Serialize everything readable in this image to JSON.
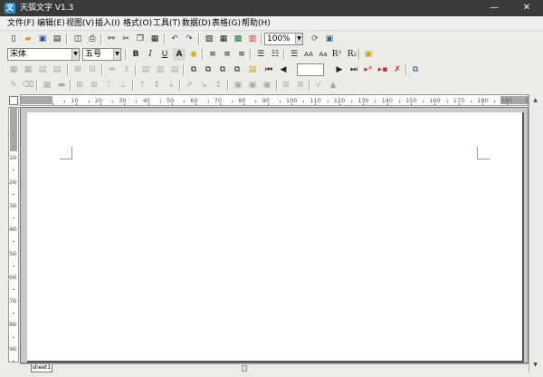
{
  "titlebar": {
    "title": "天弧文字 V1.3",
    "minimize": "—",
    "close": "✕"
  },
  "menu": [
    "文件(F)",
    "编辑(E)",
    "视图(V)",
    "插入(I)",
    "格式(O)",
    "工具(T)",
    "数据(D)",
    "表格(G)",
    "帮助(H)"
  ],
  "toolbar1": {
    "zoom": "100%"
  },
  "toolbar2": {
    "font_name": "宋体",
    "font_size": "五号",
    "bold": "B",
    "italic": "I",
    "underline": "U",
    "shade": "A",
    "superscript": "R²",
    "subscript": "R₂"
  },
  "ruler": {
    "h_labels": [
      "10",
      "20",
      "30",
      "40",
      "50",
      "60",
      "70",
      "80",
      "90",
      "100",
      "110",
      "120",
      "130",
      "140",
      "150",
      "160",
      "170",
      "180",
      "190",
      "200"
    ],
    "v_labels": [
      "10",
      "20",
      "30",
      "40",
      "50",
      "60",
      "70",
      "80",
      "90",
      "100"
    ]
  },
  "statusbar": {
    "sheet_tab": "sheet1"
  },
  "colors": {
    "titlebar": "#3a3a3a",
    "toolbar_bg": "#ecebe6",
    "page_bg": "#ffffff",
    "workspace": "#c8c8c8"
  }
}
